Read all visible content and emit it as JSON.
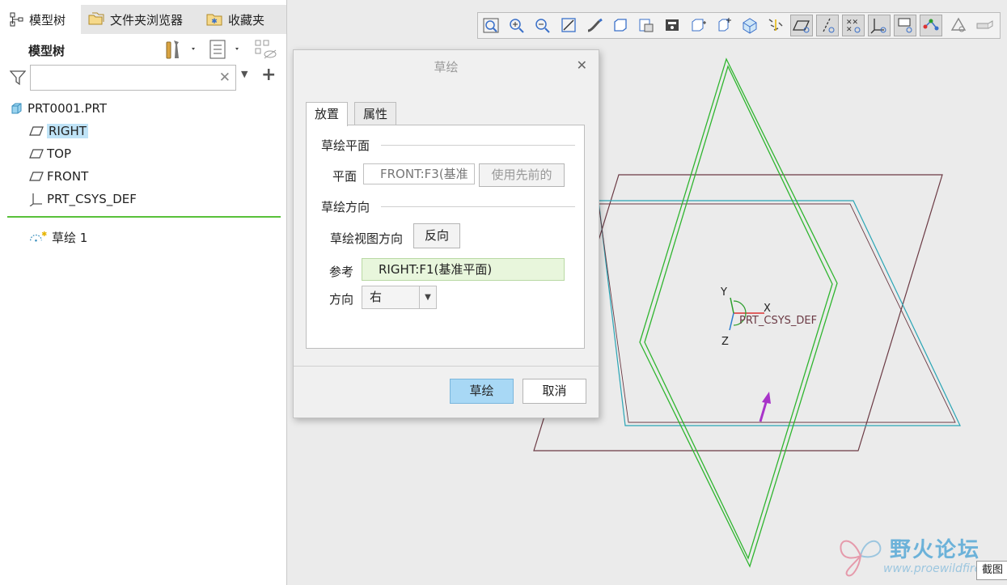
{
  "left_panel": {
    "tabs": [
      {
        "label": "模型树",
        "icon": "tree-icon"
      },
      {
        "label": "文件夹浏览器",
        "icon": "folder-browser-icon"
      },
      {
        "label": "收藏夹",
        "icon": "favorites-icon"
      }
    ],
    "title": "模型树",
    "search": {
      "value": "",
      "placeholder": ""
    },
    "tree": {
      "root": "PRT0001.PRT",
      "items": [
        {
          "label": "RIGHT",
          "icon": "datum-plane-icon",
          "selected": true
        },
        {
          "label": "TOP",
          "icon": "datum-plane-icon"
        },
        {
          "label": "FRONT",
          "icon": "datum-plane-icon"
        },
        {
          "label": "PRT_CSYS_DEF",
          "icon": "csys-icon"
        }
      ],
      "feature": "草绘 1"
    }
  },
  "dialog": {
    "title": "草绘",
    "tabs": [
      "放置",
      "属性"
    ],
    "sketch_plane_group": "草绘平面",
    "plane_label": "平面",
    "plane_value": "FRONT:F3(基准",
    "use_previous": "使用先前的",
    "orientation_group": "草绘方向",
    "view_direction_label": "草绘视图方向",
    "flip_button": "反向",
    "reference_label": "参考",
    "reference_value": "RIGHT:F1(基准平面)",
    "direction_label": "方向",
    "direction_value": "右",
    "ok_button": "草绘",
    "cancel_button": "取消"
  },
  "viewport": {
    "csys_label": "PRT_CSYS_DEF",
    "axis_x": "X",
    "axis_y": "Y",
    "axis_z": "Z"
  },
  "watermark": {
    "text": "野火论坛",
    "url": "www.proewildfire"
  },
  "capture_tip": "截图",
  "colors": {
    "selection": "#bfe3f7",
    "accent_button": "#a8d8f5",
    "reference_field": "#e8f6dc",
    "green_plane": "#2fb52f",
    "cyan_plane": "#2aa5b5",
    "maroon_plane": "#6b3a44"
  }
}
